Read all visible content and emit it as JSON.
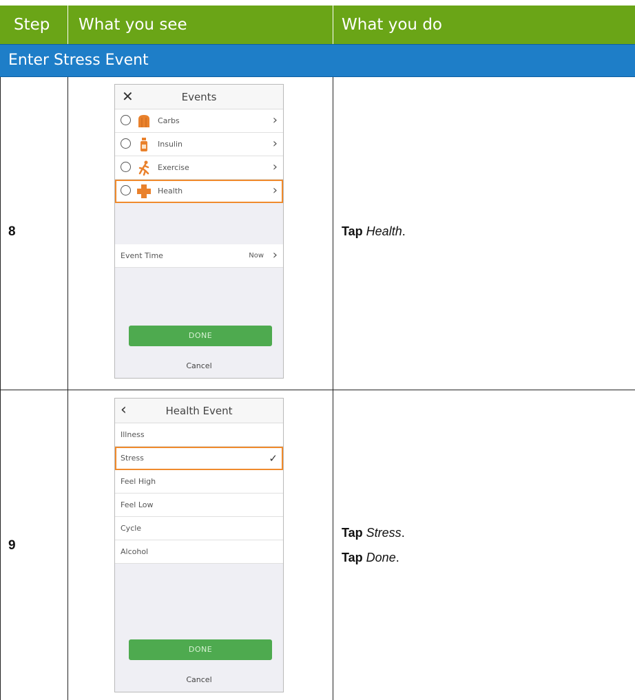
{
  "header": {
    "col_step": "Step",
    "col_see": "What you see",
    "col_do": "What you do",
    "color": "#6aa517"
  },
  "section": {
    "title": "Enter Stress Event",
    "color": "#1e7ec8"
  },
  "steps": [
    {
      "number": "8",
      "screen": {
        "title": "Events",
        "close_icon": "close-icon",
        "items": [
          {
            "label": "Carbs",
            "icon": "carbs-icon"
          },
          {
            "label": "Insulin",
            "icon": "insulin-icon"
          },
          {
            "label": "Exercise",
            "icon": "exercise-icon"
          },
          {
            "label": "Health",
            "icon": "health-icon",
            "highlighted": true
          }
        ],
        "event_time_label": "Event Time",
        "event_time_value": "Now",
        "done_label": "DONE",
        "cancel_label": "Cancel"
      },
      "instruction": {
        "verb": "Tap",
        "target": "Health",
        "end": "."
      }
    },
    {
      "number": "9",
      "screen": {
        "title": "Health Event",
        "back_icon": "back-icon",
        "items": [
          {
            "label": "Illness"
          },
          {
            "label": "Stress",
            "selected": true
          },
          {
            "label": "Feel High"
          },
          {
            "label": "Feel Low"
          },
          {
            "label": "Cycle"
          },
          {
            "label": "Alcohol"
          }
        ],
        "done_label": "DONE",
        "cancel_label": "Cancel"
      },
      "instructions": [
        {
          "verb": "Tap",
          "target": "Stress",
          "end": "."
        },
        {
          "verb": "Tap",
          "target": "Done",
          "end": "."
        }
      ]
    }
  ],
  "colors": {
    "highlight": "#f08a2c",
    "done_button": "#4eaa4f",
    "icon_orange": "#f08a2c"
  }
}
